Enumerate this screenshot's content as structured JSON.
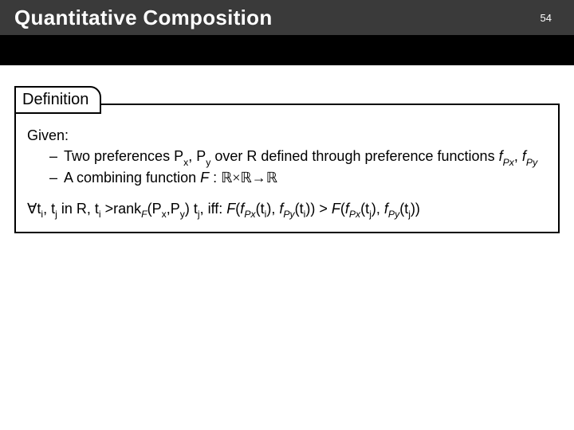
{
  "header": {
    "title": "Quantitative Composition",
    "page_number": "54"
  },
  "definition": {
    "tab_label": "Definition",
    "given_label": "Given:",
    "bullets": {
      "b1_pre": "Two preferences P",
      "b1_x": "x",
      "b1_mid": ", P",
      "b1_y": "y",
      "b1_post": " over R defined through preference functions ",
      "b1_f": "f",
      "b1_fpx": "Px",
      "b1_sep": ", ",
      "b1_fpy": "Py",
      "b2_pre": "A combining function ",
      "b2_F": "F",
      "b2_colon": " : ",
      "b2_domain": "ℝ×ℝ→ℝ"
    },
    "conclusion": {
      "forall": "∀",
      "ti": "t",
      "i": "i",
      "comma": ", ",
      "tj": "t",
      "j": "j",
      "in_r": " in R, ",
      "rank_pre": " >rank",
      "F": "F",
      "lpar": "(",
      "Px": "P",
      "x": "x",
      "Py": "P",
      "y": "y",
      "rpar": ") ",
      "iff": ", iff: ",
      "f": "f",
      "Pxs": "Px",
      "Pys": "Py",
      "gt": " > ",
      "close": "))"
    }
  }
}
